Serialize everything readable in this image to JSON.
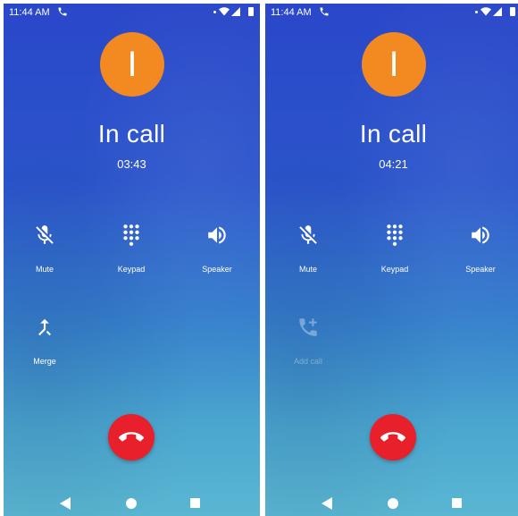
{
  "screens": [
    {
      "status": {
        "time": "11:44 AM"
      },
      "avatar_letter": "I",
      "call_state": "In call",
      "timer": "03:43",
      "controls": {
        "mute": "Mute",
        "keypad": "Keypad",
        "speaker": "Speaker",
        "extra": "Merge"
      }
    },
    {
      "status": {
        "time": "11:44 AM"
      },
      "avatar_letter": "I",
      "call_state": "In call",
      "timer": "04:21",
      "controls": {
        "mute": "Mute",
        "keypad": "Keypad",
        "speaker": "Speaker",
        "extra": "Add call"
      }
    }
  ],
  "colors": {
    "avatar": "#f28a21",
    "end_call": "#e8202c",
    "background_top": "#2a47c9",
    "background_bottom": "#5ab7d2"
  },
  "icons": {
    "status": [
      "phone-call-icon",
      "wifi-icon",
      "signal-icon",
      "battery-icon"
    ],
    "controls": [
      "mic-off-icon",
      "dialpad-icon",
      "volume-icon",
      "merge-icon",
      "add-call-icon"
    ],
    "navigation": [
      "back-icon",
      "home-icon",
      "recents-icon"
    ],
    "end_call": "call-end-icon"
  }
}
